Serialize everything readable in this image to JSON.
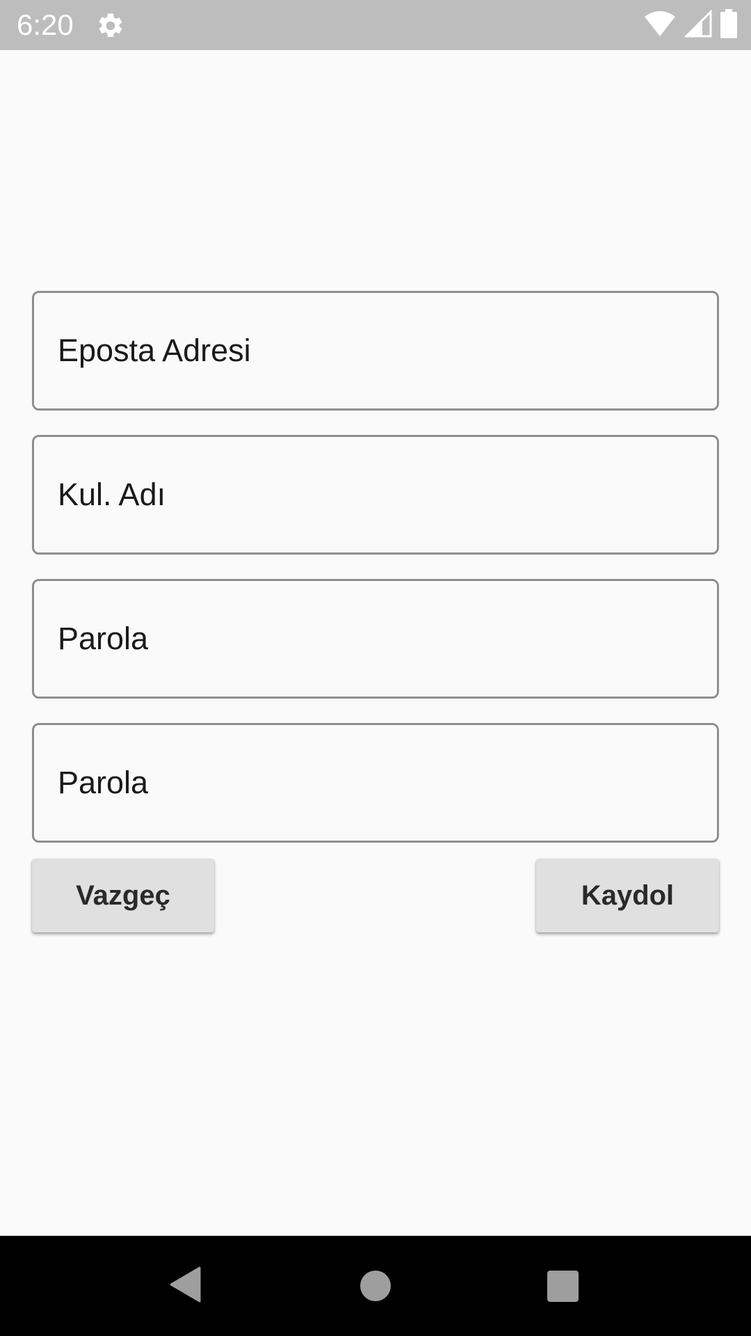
{
  "status_bar": {
    "time": "6:20",
    "icons": [
      "settings-gear-icon",
      "wifi-icon",
      "cellular-signal-icon",
      "battery-icon"
    ],
    "color": "#bdbdbd"
  },
  "form": {
    "fields": [
      {
        "placeholder": "Eposta Adresi"
      },
      {
        "placeholder": "Kul. Adı"
      },
      {
        "placeholder": "Parola"
      },
      {
        "placeholder": "Parola"
      }
    ],
    "buttons": {
      "cancel_label": "Vazgeç",
      "register_label": "Kaydol"
    }
  },
  "nav_bar": {
    "icons": [
      "back-icon",
      "home-icon",
      "recents-icon"
    ]
  }
}
